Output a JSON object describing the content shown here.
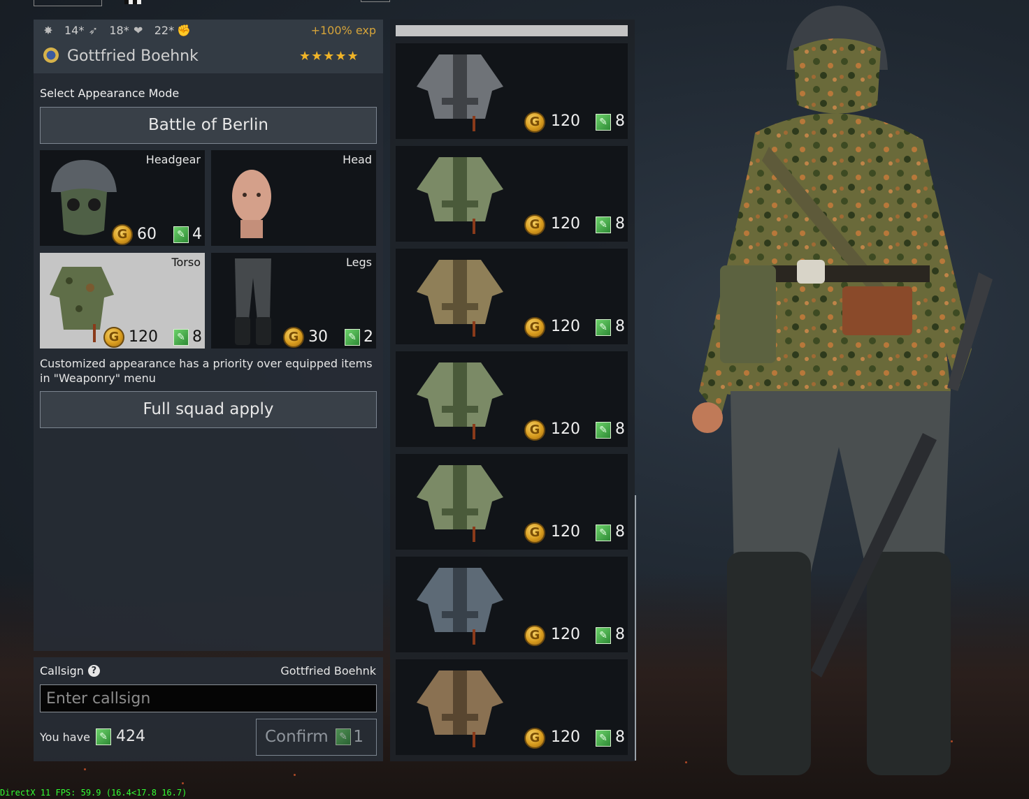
{
  "soldier": {
    "stats": [
      {
        "icon": "rank-icon",
        "value": ""
      },
      {
        "icon": "stamina-icon",
        "value": "14*"
      },
      {
        "icon": "health-icon",
        "value": "18*"
      },
      {
        "icon": "strength-icon",
        "value": "22*"
      }
    ],
    "exp_bonus": "+100% exp",
    "name": "Gottfried Boehnk",
    "stars": "★★★★★"
  },
  "appearance": {
    "mode_label": "Select Appearance Mode",
    "mode_value": "Battle of Berlin",
    "slots": [
      {
        "title": "Headgear",
        "gold": "60",
        "tickets": "4"
      },
      {
        "title": "Head",
        "gold": "",
        "tickets": ""
      },
      {
        "title": "Torso",
        "gold": "120",
        "tickets": "8"
      },
      {
        "title": "Legs",
        "gold": "30",
        "tickets": "2"
      }
    ],
    "note": "Customized appearance has a priority over equipped items in \"Weaponry\" menu",
    "squad_button": "Full squad apply"
  },
  "callsign": {
    "label": "Callsign",
    "current": "Gottfried Boehnk",
    "placeholder": "Enter callsign",
    "you_have_label": "You have",
    "you_have_value": "424",
    "confirm_label": "Confirm",
    "confirm_cost": "1"
  },
  "items": [
    {
      "name": "grey-jacket",
      "gold": "120",
      "tickets": "8",
      "colors": {
        "main": "#6f7378",
        "dark": "#3f4246"
      }
    },
    {
      "name": "camo-jacket-foliage",
      "gold": "120",
      "tickets": "8",
      "colors": {
        "main": "#7b8a66",
        "dark": "#4a5a3a"
      }
    },
    {
      "name": "tan-camo-jacket",
      "gold": "120",
      "tickets": "8",
      "colors": {
        "main": "#8f7f58",
        "dark": "#5e5236"
      }
    },
    {
      "name": "camo-jacket-foliage-2",
      "gold": "120",
      "tickets": "8",
      "colors": {
        "main": "#7b8a66",
        "dark": "#4a5a3a"
      }
    },
    {
      "name": "camo-jacket-foliage-3",
      "gold": "120",
      "tickets": "8",
      "colors": {
        "main": "#7b8a66",
        "dark": "#4a5a3a"
      }
    },
    {
      "name": "blue-grey-jacket",
      "gold": "120",
      "tickets": "8",
      "colors": {
        "main": "#5d6a76",
        "dark": "#38414a"
      }
    },
    {
      "name": "brown-jacket",
      "gold": "120",
      "tickets": "8",
      "colors": {
        "main": "#8a7152",
        "dark": "#584630"
      }
    }
  ],
  "fps_text": "DirectX 11 FPS: 59.9 (16.4<17.8 16.7)"
}
